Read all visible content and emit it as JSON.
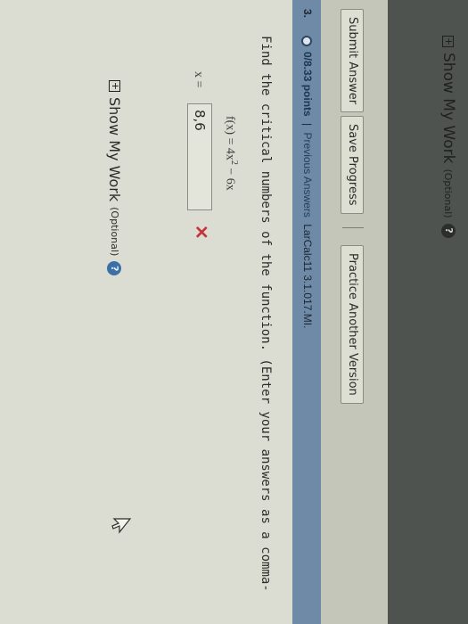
{
  "previous_question": {
    "show_my_work": "Show My Work",
    "optional": "(Optional)",
    "help_icon": "question-icon"
  },
  "toolbar": {
    "submit": "Submit Answer",
    "save": "Save Progress",
    "practice": "Practice Another Version"
  },
  "question": {
    "number": "3.",
    "points": "0/8.33 points",
    "separator": "|",
    "previous_answers": "Previous Answers",
    "reference": "LarCalc11 3.1.017.MI.",
    "instructions": "Find the critical numbers of the function. (Enter your answers as a comma-",
    "function_lhs": "f(x) = 4x",
    "function_exp": "2",
    "function_rhs": " − 6x",
    "answer_label": "x =",
    "answer_value": "8,6",
    "wrong_mark": "✕",
    "show_my_work": "Show My Work",
    "optional": "(Optional)",
    "help_symbol": "?"
  },
  "colors": {
    "header_bar": "#6f8aa6",
    "wrong": "#c4343b",
    "dark_band": "#4f5350"
  }
}
